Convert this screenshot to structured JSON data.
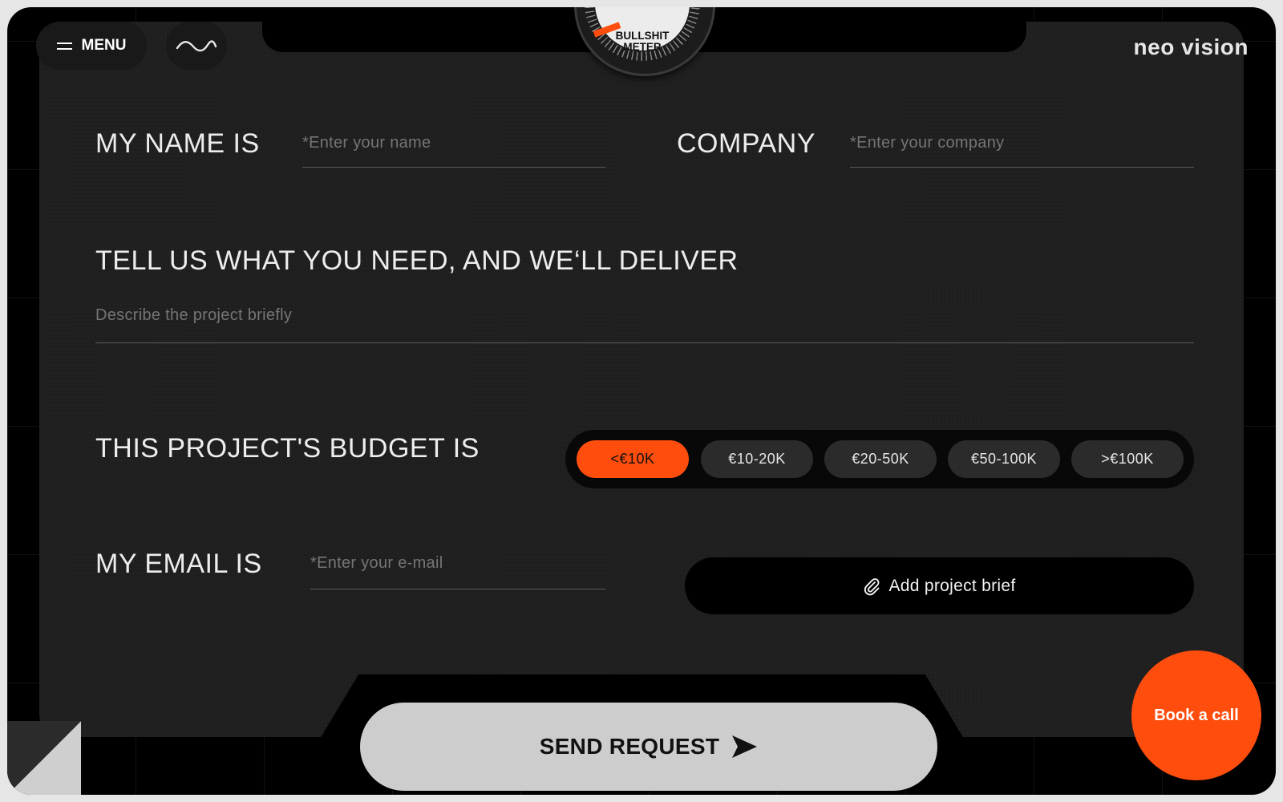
{
  "header": {
    "menu_label": "MENU",
    "logo_text": "neo vision"
  },
  "meter": {
    "line1": "BULLSHIT",
    "line2": "METER"
  },
  "form": {
    "name_label": "MY NAME IS",
    "name_placeholder": "*Enter your name",
    "company_label": "COMPANY",
    "company_placeholder": "*Enter your company",
    "need_heading": "TELL US WHAT YOU NEED, AND WE‘LL DELIVER",
    "description_placeholder": "Describe the project briefly",
    "budget_label": "THIS PROJECT'S BUDGET IS",
    "budget_options": [
      "<€10K",
      "€10-20K",
      "€20-50K",
      "€50-100K",
      ">€100K"
    ],
    "budget_selected": "<€10K",
    "email_label": "MY EMAIL IS",
    "email_placeholder": "*Enter your e-mail",
    "brief_button": "Add project brief",
    "send_button": "SEND REQUEST"
  },
  "cta": {
    "book_call": "Book a call"
  },
  "colors": {
    "accent": "#ff4d0d",
    "panel": "#1f1f1f",
    "background": "#000000",
    "send_button": "#cdcdcd"
  },
  "icons": [
    "menu-icon",
    "wave-icon",
    "paperclip-icon",
    "send-arrow-icon"
  ]
}
